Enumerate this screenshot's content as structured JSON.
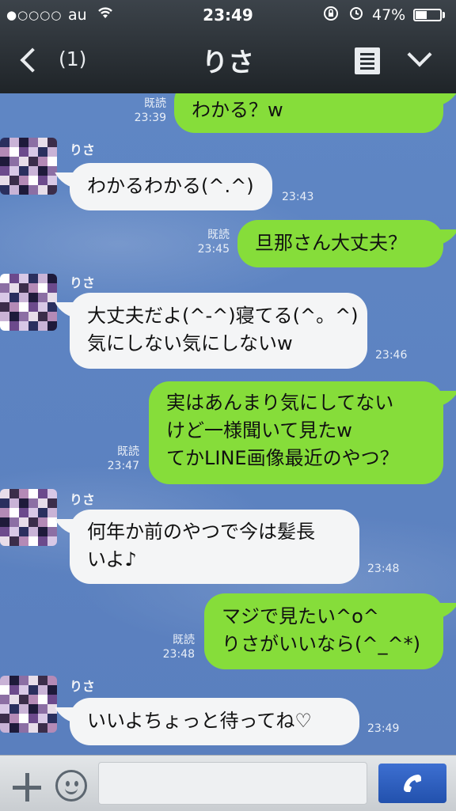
{
  "status_bar": {
    "signal": "●○○○○",
    "carrier": "au",
    "time": "23:49",
    "battery_pct": "47%",
    "battery_level": 0.47
  },
  "header": {
    "back_count": "(1)",
    "title": "りさ"
  },
  "messages": [
    {
      "dir": "out",
      "read": "既読",
      "time": "23:39",
      "lines": [
        "わかる？w"
      ]
    },
    {
      "dir": "in",
      "sender": "りさ",
      "time": "23:43",
      "lines": [
        "わかるわかる(^.^)"
      ]
    },
    {
      "dir": "out",
      "read": "既読",
      "time": "23:45",
      "lines": [
        "旦那さん大丈夫？"
      ]
    },
    {
      "dir": "in",
      "sender": "りさ",
      "time": "23:46",
      "lines": [
        "大丈夫だよ(^-^)寝てる(^。^)",
        "気にしない気にしないw"
      ]
    },
    {
      "dir": "out",
      "read": "既読",
      "time": "23:47",
      "lines": [
        "実はあんまり気にしてない",
        "けど一様聞いて見たw",
        "てかLINE画像最近のやつ？"
      ]
    },
    {
      "dir": "in",
      "sender": "りさ",
      "time": "23:48",
      "lines": [
        "何年か前のやつで今は髪長",
        "いよ♪"
      ]
    },
    {
      "dir": "out",
      "read": "既読",
      "time": "23:48",
      "lines": [
        "マジで見たい^o^",
        "りさがいいなら(^_^*)"
      ]
    },
    {
      "dir": "in",
      "sender": "りさ",
      "time": "23:49",
      "lines": [
        "いいよちょっと待ってね♡"
      ]
    }
  ],
  "colors": {
    "outgoing_bubble": "#86dd3a",
    "incoming_bubble": "#f4f5f6",
    "chat_background": "#5b84c2",
    "call_button": "#2a5bbd"
  },
  "icons": {
    "back": "chevron-left-icon",
    "menu": "note-list-icon",
    "expand": "chevron-down-icon",
    "add": "plus-icon",
    "emoji": "smiley-icon",
    "call": "phone-icon"
  }
}
